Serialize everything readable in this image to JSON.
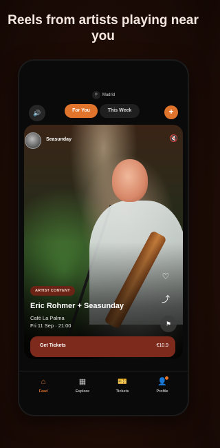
{
  "headline": "Reels from artists playing near you",
  "location": {
    "label": "Madrid",
    "icon": "pin-icon"
  },
  "tabs": [
    {
      "label": "For You",
      "active": true
    },
    {
      "label": "This Week",
      "active": false
    }
  ],
  "reel": {
    "artist_name": "Seasunday",
    "badge": "ARTIST CONTENT",
    "title": "Eric Rohmer + Seasunday",
    "venue": "Café La Palma",
    "date": "Fri 11 Sep · 21:00",
    "cta_label": "Get Tickets",
    "price": "€10.9"
  },
  "nav": [
    {
      "label": "Feed",
      "icon": "home-icon",
      "active": true
    },
    {
      "label": "Explore",
      "icon": "grid-icon",
      "active": false
    },
    {
      "label": "Tickets",
      "icon": "ticket-icon",
      "active": false
    },
    {
      "label": "Profile",
      "icon": "user-icon",
      "active": false,
      "badge_dot": true
    }
  ],
  "colors": {
    "accent": "#e0742c",
    "cta": "#7d2a1c",
    "badge": "#6a2315"
  }
}
